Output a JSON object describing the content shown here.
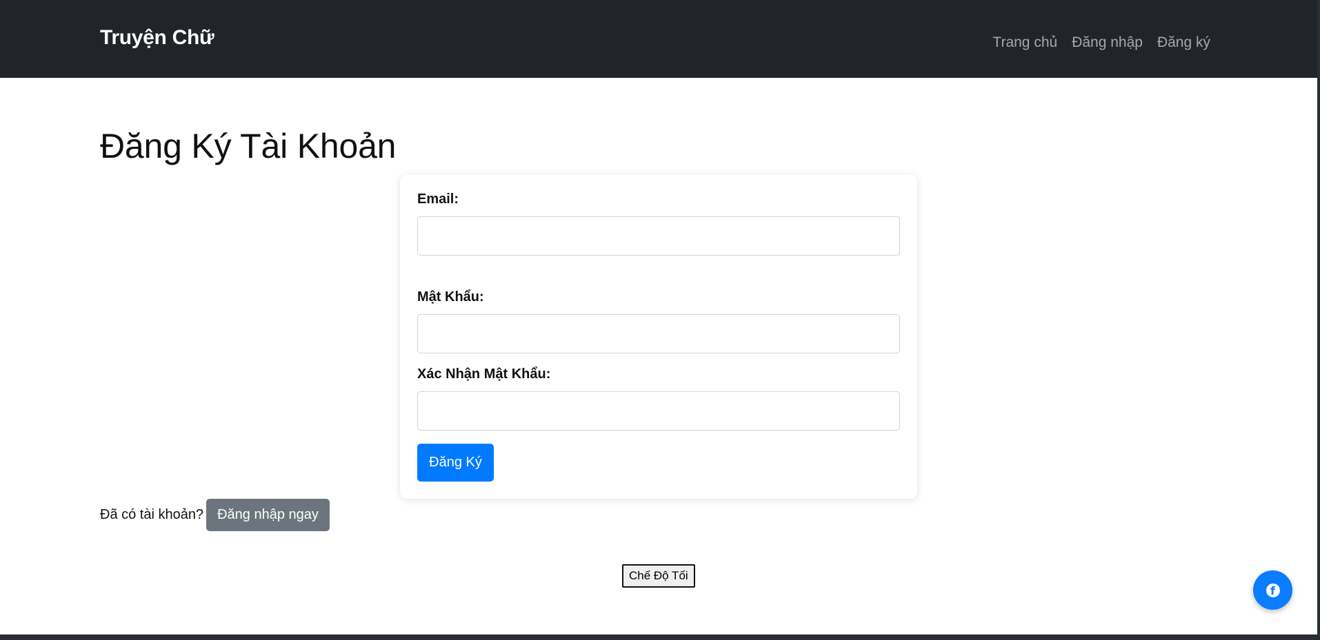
{
  "navbar": {
    "brand": "Truyện Chữ",
    "links": [
      {
        "label": "Trang chủ"
      },
      {
        "label": "Đăng nhập"
      },
      {
        "label": "Đăng ký"
      }
    ]
  },
  "main": {
    "title": "Đăng Ký Tài Khoản",
    "form": {
      "email": {
        "label": "Email:",
        "value": "",
        "placeholder": ""
      },
      "password": {
        "label": "Mật Khẩu:",
        "value": "",
        "placeholder": ""
      },
      "confirm_password": {
        "label": "Xác Nhận Mật Khẩu:",
        "value": "",
        "placeholder": ""
      },
      "submit_label": "Đăng Ký"
    },
    "login_prompt": {
      "text": "Đã có tài khoản?",
      "button_label": "Đăng nhập ngay"
    },
    "dark_mode_label": "Chế Độ Tối"
  },
  "floating_button": {
    "icon": "facebook-icon",
    "glyph": "f"
  },
  "colors": {
    "navbar_bg": "#212529",
    "primary": "#007bff",
    "secondary": "#6c757d",
    "facebook_blue": "#0a7cff"
  }
}
